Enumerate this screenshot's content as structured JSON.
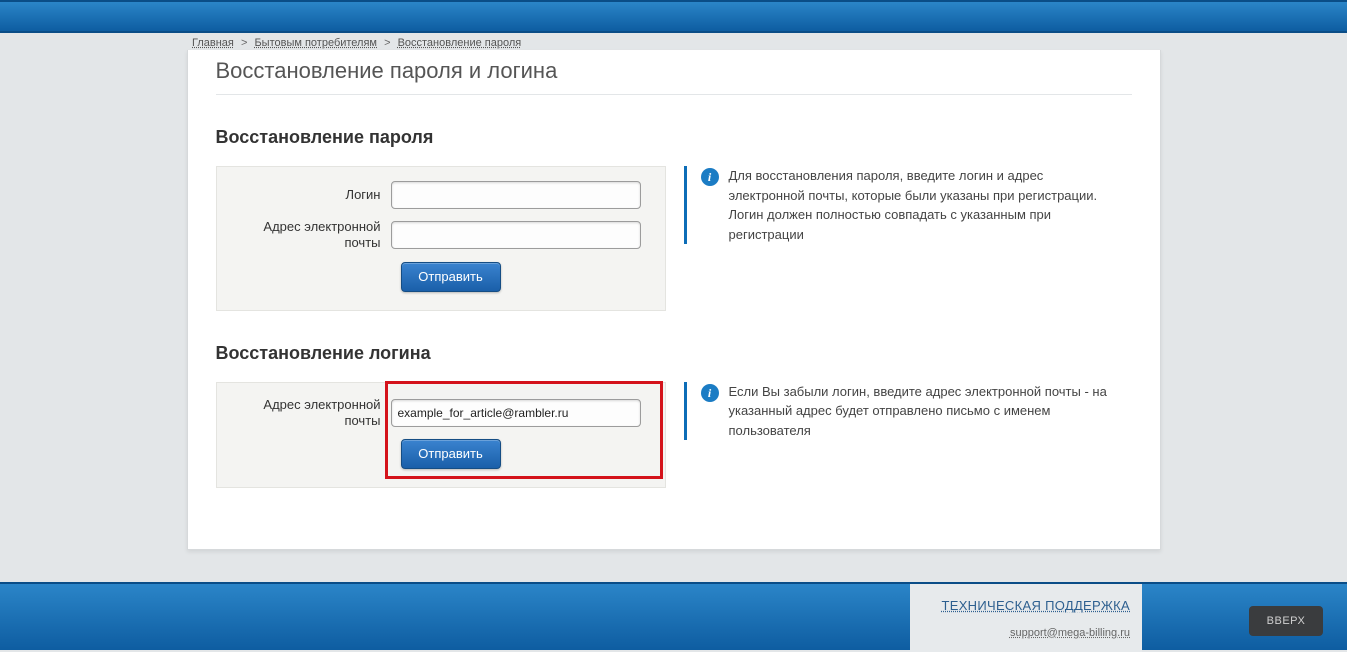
{
  "breadcrumbs": {
    "home": "Главная",
    "consumers": "Бытовым потребителям",
    "recovery": "Восстановление пароля"
  },
  "page_title": "Восстановление пароля и логина",
  "section_password": {
    "title": "Восстановление пароля",
    "login_label": "Логин",
    "email_label": "Адрес электронной почты",
    "login_value": "",
    "email_value": "",
    "submit": "Отправить",
    "info": "Для восстановления пароля, введите логин и адрес электронной почты, которые были указаны при регистрации. Логин должен полностью совпадать с указанным при регистрации"
  },
  "section_login": {
    "title": "Восстановление логина",
    "email_label": "Адрес электронной почты",
    "email_value": "example_for_article@rambler.ru",
    "submit": "Отправить",
    "info": "Если Вы забыли логин, введите адрес электронной почты - на указанный адрес будет отправлено письмо с именем пользователя"
  },
  "footer": {
    "support_title": "ТЕХНИЧЕСКАЯ ПОДДЕРЖКА",
    "support_email": "support@mega-billing.ru",
    "up": "ВВЕРХ"
  },
  "icons": {
    "info_glyph": "i"
  }
}
